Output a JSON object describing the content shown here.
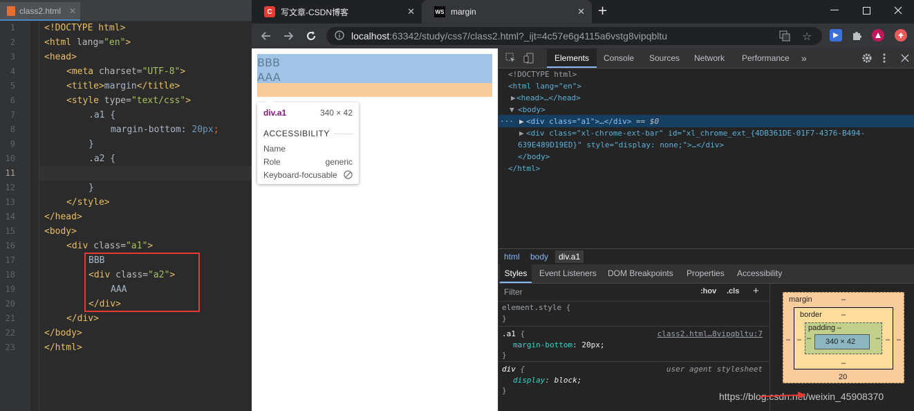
{
  "ide": {
    "tab_filename": "class2.html",
    "tab_close": "✕",
    "lines": [
      "1",
      "2",
      "3",
      "4",
      "5",
      "6",
      "7",
      "8",
      "9",
      "10",
      "11",
      "12",
      "13",
      "14",
      "15",
      "16",
      "17",
      "18",
      "19",
      "20",
      "21",
      "22",
      "23"
    ],
    "code": {
      "l1": "<!DOCTYPE html>",
      "l2a": "<html ",
      "l2b": "lang=",
      "l2c": "\"en\"",
      "l2d": ">",
      "l3": "<head>",
      "l4a": "<meta ",
      "l4b": "charset=",
      "l4c": "\"UTF-8\"",
      "l4d": ">",
      "l5a": "<title>",
      "l5b": "margin",
      "l5c": "</title>",
      "l6a": "<style ",
      "l6b": "type=",
      "l6c": "\"text/css\"",
      "l6d": ">",
      "l7": ".a1 {",
      "l8a": "margin-bottom",
      "l8b": ": ",
      "l8c": "20px",
      "l8d": ";",
      "l9": "}",
      "l10": ".a2 {",
      "l11": "",
      "l12": "}",
      "l13": "</style>",
      "l14": "</head>",
      "l15": "<body>",
      "l16a": "<div ",
      "l16b": "class=",
      "l16c": "\"a1\"",
      "l16d": ">",
      "l17": "BBB",
      "l18a": "<div ",
      "l18b": "class=",
      "l18c": "\"a2\"",
      "l18d": ">",
      "l19": "AAA",
      "l20": "</div>",
      "l21": "</div>",
      "l22": "</body>",
      "l23": "</html>"
    }
  },
  "browser": {
    "tab1_title": "写文章-CSDN博客",
    "tab1_icon_text": "C",
    "tab2_title": "margin",
    "tab2_icon_text": "WS",
    "tab_close": "✕",
    "new_tab": "+",
    "url_host": "localhost",
    "url_path": ":63342/study/css7/class2.html?_ijt=4c57e6g4115a6vstg8vipqbltu",
    "page_text_bbb": "BBB",
    "page_text_aaa": "AAA",
    "tooltip": {
      "selector": "div.a1",
      "size": "340 × 42",
      "section": "ACCESSIBILITY",
      "name_label": "Name",
      "name_value": "",
      "role_label": "Role",
      "role_value": "generic",
      "focus_label": "Keyboard-focusable"
    }
  },
  "devtools": {
    "tabs": [
      "Elements",
      "Console",
      "Sources",
      "Network",
      "Performance"
    ],
    "more_tabs": "»",
    "dom": {
      "doctype": "<!DOCTYPE html>",
      "html_open": "<html lang=\"en\">",
      "head": "<head>…</head>",
      "body_open": "<body>",
      "div_a1": "<div class=\"a1\">…</div>",
      "div_a1_suffix": " == $0",
      "div_ext_1": "<div class=\"xl-chrome-ext-bar\" id=\"xl_chrome_ext_{4DB361DE-01F7-4376-B494-",
      "div_ext_2": "639E489D19ED}\" style=\"display: none;\">…</div>",
      "body_close": "</body>",
      "html_close": "</html>",
      "dots": "···"
    },
    "breadcrumbs": [
      "html",
      "body",
      "div.a1"
    ],
    "styles_tabs": [
      "Styles",
      "Event Listeners",
      "DOM Breakpoints",
      "Properties",
      "Accessibility"
    ],
    "filter_placeholder": "Filter",
    "hov": ":hov",
    "cls": ".cls",
    "plus": "+",
    "rules": {
      "element_style": "element.style {",
      "close": "}",
      "a1_selector": ".a1",
      "a1_source": "class2.html…8vipqbltu:7",
      "a1_prop": "margin-bottom",
      "a1_val": "20px;",
      "div_selector": "div",
      "div_source": "user agent stylesheet",
      "div_prop": "display",
      "div_val": "block;"
    },
    "boxmodel": {
      "margin": "margin",
      "border": "border",
      "padding": "padding",
      "content": "340 × 42",
      "dash": "–",
      "bottom_margin": "20"
    }
  },
  "watermark": "https://blog.csdn.net/weixin_45908370",
  "colors": {
    "content_highlight": "#a1c4e6",
    "margin_highlight": "#f8cc9a",
    "annotation_red": "#e53935"
  }
}
